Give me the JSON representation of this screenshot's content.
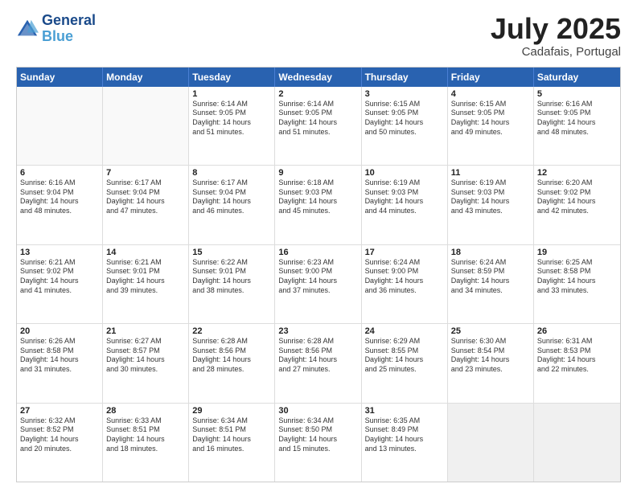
{
  "header": {
    "logo_line1": "General",
    "logo_line2": "Blue",
    "month_year": "July 2025",
    "location": "Cadafais, Portugal"
  },
  "weekdays": [
    "Sunday",
    "Monday",
    "Tuesday",
    "Wednesday",
    "Thursday",
    "Friday",
    "Saturday"
  ],
  "rows": [
    [
      {
        "day": "",
        "empty": true
      },
      {
        "day": "",
        "empty": true
      },
      {
        "day": "1",
        "lines": [
          "Sunrise: 6:14 AM",
          "Sunset: 9:05 PM",
          "Daylight: 14 hours",
          "and 51 minutes."
        ]
      },
      {
        "day": "2",
        "lines": [
          "Sunrise: 6:14 AM",
          "Sunset: 9:05 PM",
          "Daylight: 14 hours",
          "and 51 minutes."
        ]
      },
      {
        "day": "3",
        "lines": [
          "Sunrise: 6:15 AM",
          "Sunset: 9:05 PM",
          "Daylight: 14 hours",
          "and 50 minutes."
        ]
      },
      {
        "day": "4",
        "lines": [
          "Sunrise: 6:15 AM",
          "Sunset: 9:05 PM",
          "Daylight: 14 hours",
          "and 49 minutes."
        ]
      },
      {
        "day": "5",
        "lines": [
          "Sunrise: 6:16 AM",
          "Sunset: 9:05 PM",
          "Daylight: 14 hours",
          "and 48 minutes."
        ]
      }
    ],
    [
      {
        "day": "6",
        "lines": [
          "Sunrise: 6:16 AM",
          "Sunset: 9:04 PM",
          "Daylight: 14 hours",
          "and 48 minutes."
        ]
      },
      {
        "day": "7",
        "lines": [
          "Sunrise: 6:17 AM",
          "Sunset: 9:04 PM",
          "Daylight: 14 hours",
          "and 47 minutes."
        ]
      },
      {
        "day": "8",
        "lines": [
          "Sunrise: 6:17 AM",
          "Sunset: 9:04 PM",
          "Daylight: 14 hours",
          "and 46 minutes."
        ]
      },
      {
        "day": "9",
        "lines": [
          "Sunrise: 6:18 AM",
          "Sunset: 9:03 PM",
          "Daylight: 14 hours",
          "and 45 minutes."
        ]
      },
      {
        "day": "10",
        "lines": [
          "Sunrise: 6:19 AM",
          "Sunset: 9:03 PM",
          "Daylight: 14 hours",
          "and 44 minutes."
        ]
      },
      {
        "day": "11",
        "lines": [
          "Sunrise: 6:19 AM",
          "Sunset: 9:03 PM",
          "Daylight: 14 hours",
          "and 43 minutes."
        ]
      },
      {
        "day": "12",
        "lines": [
          "Sunrise: 6:20 AM",
          "Sunset: 9:02 PM",
          "Daylight: 14 hours",
          "and 42 minutes."
        ]
      }
    ],
    [
      {
        "day": "13",
        "lines": [
          "Sunrise: 6:21 AM",
          "Sunset: 9:02 PM",
          "Daylight: 14 hours",
          "and 41 minutes."
        ]
      },
      {
        "day": "14",
        "lines": [
          "Sunrise: 6:21 AM",
          "Sunset: 9:01 PM",
          "Daylight: 14 hours",
          "and 39 minutes."
        ]
      },
      {
        "day": "15",
        "lines": [
          "Sunrise: 6:22 AM",
          "Sunset: 9:01 PM",
          "Daylight: 14 hours",
          "and 38 minutes."
        ]
      },
      {
        "day": "16",
        "lines": [
          "Sunrise: 6:23 AM",
          "Sunset: 9:00 PM",
          "Daylight: 14 hours",
          "and 37 minutes."
        ]
      },
      {
        "day": "17",
        "lines": [
          "Sunrise: 6:24 AM",
          "Sunset: 9:00 PM",
          "Daylight: 14 hours",
          "and 36 minutes."
        ]
      },
      {
        "day": "18",
        "lines": [
          "Sunrise: 6:24 AM",
          "Sunset: 8:59 PM",
          "Daylight: 14 hours",
          "and 34 minutes."
        ]
      },
      {
        "day": "19",
        "lines": [
          "Sunrise: 6:25 AM",
          "Sunset: 8:58 PM",
          "Daylight: 14 hours",
          "and 33 minutes."
        ]
      }
    ],
    [
      {
        "day": "20",
        "lines": [
          "Sunrise: 6:26 AM",
          "Sunset: 8:58 PM",
          "Daylight: 14 hours",
          "and 31 minutes."
        ]
      },
      {
        "day": "21",
        "lines": [
          "Sunrise: 6:27 AM",
          "Sunset: 8:57 PM",
          "Daylight: 14 hours",
          "and 30 minutes."
        ]
      },
      {
        "day": "22",
        "lines": [
          "Sunrise: 6:28 AM",
          "Sunset: 8:56 PM",
          "Daylight: 14 hours",
          "and 28 minutes."
        ]
      },
      {
        "day": "23",
        "lines": [
          "Sunrise: 6:28 AM",
          "Sunset: 8:56 PM",
          "Daylight: 14 hours",
          "and 27 minutes."
        ]
      },
      {
        "day": "24",
        "lines": [
          "Sunrise: 6:29 AM",
          "Sunset: 8:55 PM",
          "Daylight: 14 hours",
          "and 25 minutes."
        ]
      },
      {
        "day": "25",
        "lines": [
          "Sunrise: 6:30 AM",
          "Sunset: 8:54 PM",
          "Daylight: 14 hours",
          "and 23 minutes."
        ]
      },
      {
        "day": "26",
        "lines": [
          "Sunrise: 6:31 AM",
          "Sunset: 8:53 PM",
          "Daylight: 14 hours",
          "and 22 minutes."
        ]
      }
    ],
    [
      {
        "day": "27",
        "lines": [
          "Sunrise: 6:32 AM",
          "Sunset: 8:52 PM",
          "Daylight: 14 hours",
          "and 20 minutes."
        ]
      },
      {
        "day": "28",
        "lines": [
          "Sunrise: 6:33 AM",
          "Sunset: 8:51 PM",
          "Daylight: 14 hours",
          "and 18 minutes."
        ]
      },
      {
        "day": "29",
        "lines": [
          "Sunrise: 6:34 AM",
          "Sunset: 8:51 PM",
          "Daylight: 14 hours",
          "and 16 minutes."
        ]
      },
      {
        "day": "30",
        "lines": [
          "Sunrise: 6:34 AM",
          "Sunset: 8:50 PM",
          "Daylight: 14 hours",
          "and 15 minutes."
        ]
      },
      {
        "day": "31",
        "lines": [
          "Sunrise: 6:35 AM",
          "Sunset: 8:49 PM",
          "Daylight: 14 hours",
          "and 13 minutes."
        ]
      },
      {
        "day": "",
        "empty": true,
        "shaded": true
      },
      {
        "day": "",
        "empty": true,
        "shaded": true
      }
    ]
  ]
}
